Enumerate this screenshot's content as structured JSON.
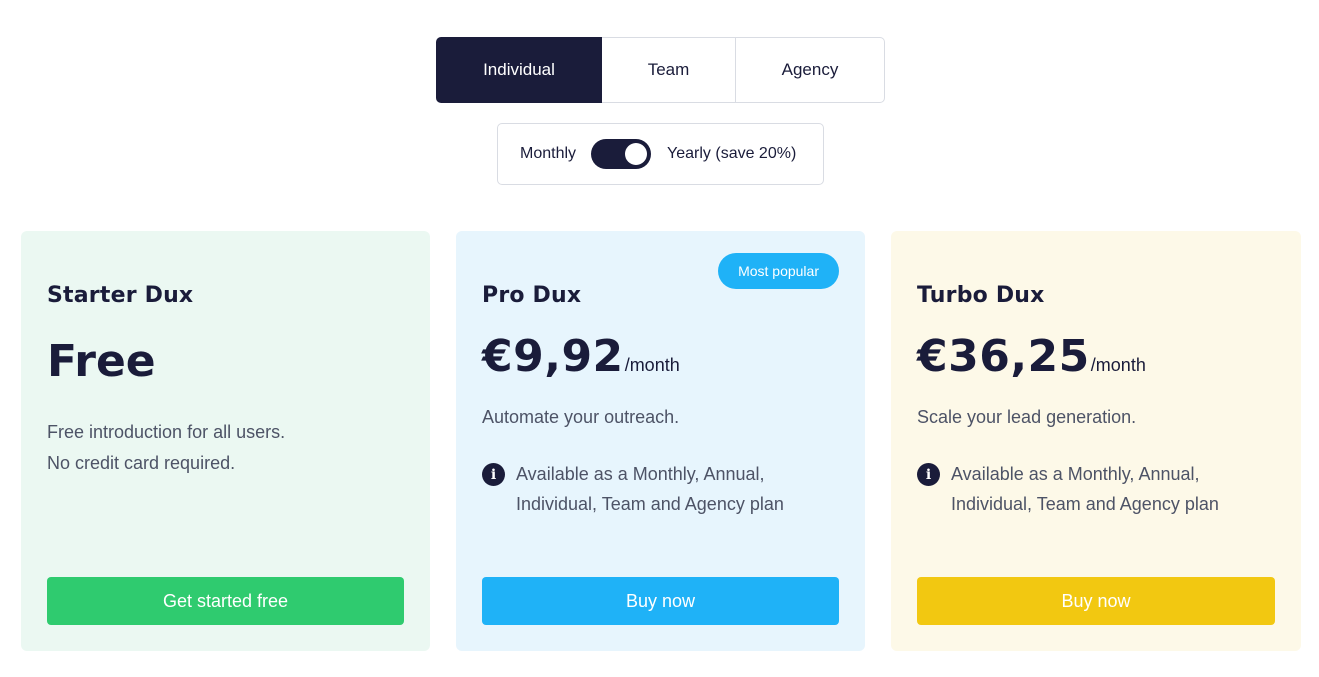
{
  "plan_tabs": [
    {
      "label": "Individual",
      "selected": true
    },
    {
      "label": "Team",
      "selected": false
    },
    {
      "label": "Agency",
      "selected": false
    }
  ],
  "billing": {
    "monthly_label": "Monthly",
    "yearly_label": "Yearly (save 20%)",
    "yearly_selected": true
  },
  "plans": [
    {
      "name": "Starter Dux",
      "price": "Free",
      "description_lines": [
        "Free introduction for all users.",
        "No credit card required."
      ],
      "cta": "Get started free",
      "color": "#2fcb6f",
      "background": "#ebf8f2"
    },
    {
      "name": "Pro Dux",
      "badge": "Most popular",
      "price": "€9,92",
      "period": "/month",
      "description": "Automate your outreach.",
      "info_icon": "info-icon",
      "note": "Available as a Monthly, Annual, Individual, Team and Agency plan",
      "cta": "Buy now",
      "color": "#1fb2f7",
      "background": "#e7f5fd"
    },
    {
      "name": "Turbo Dux",
      "price": "€36,25",
      "period": "/month",
      "description": "Scale your lead generation.",
      "info_icon": "info-icon",
      "note": "Available as a Monthly, Annual, Individual, Team and Agency plan",
      "cta": "Buy now",
      "color": "#f2c811",
      "background": "#fdf9e8"
    }
  ],
  "colors": {
    "navy": "#1a1c3a",
    "body_text": "#4d5366",
    "border": "#d9dce3"
  }
}
